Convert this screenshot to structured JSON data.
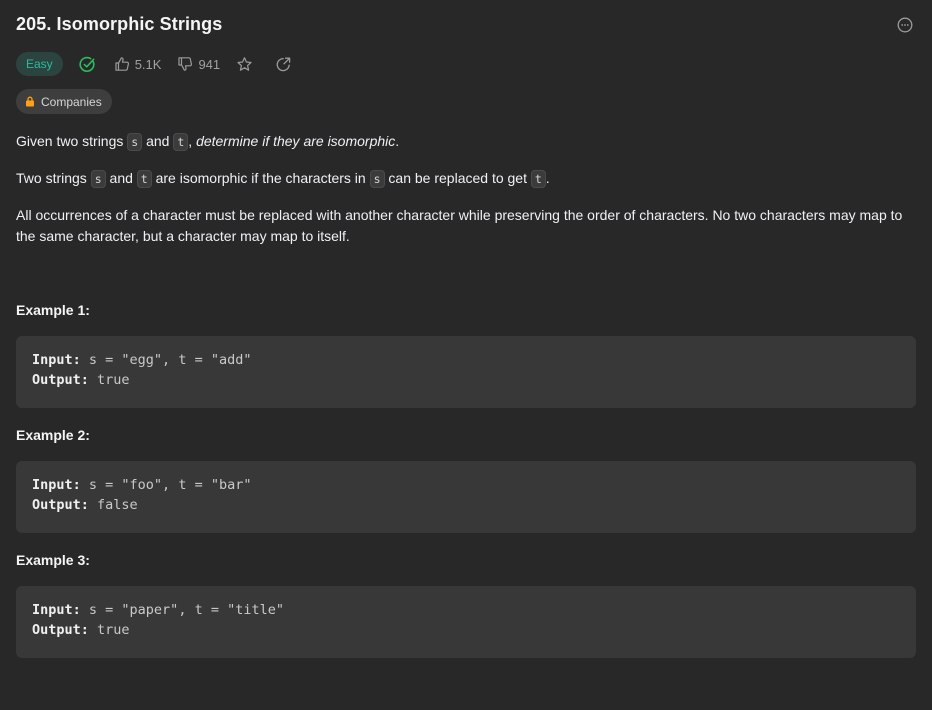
{
  "problem": {
    "title": "205. Isomorphic Strings",
    "difficulty": "Easy",
    "likes": "5.1K",
    "dislikes": "941",
    "companies_label": "Companies"
  },
  "description": {
    "p1_a": "Given two strings ",
    "p1_s": "s",
    "p1_b": " and ",
    "p1_t": "t",
    "p1_c": ", ",
    "p1_em": "determine if they are isomorphic",
    "p1_d": ".",
    "p2_a": "Two strings ",
    "p2_s": "s",
    "p2_b": " and ",
    "p2_t": "t",
    "p2_c": " are isomorphic if the characters in ",
    "p2_s2": "s",
    "p2_d": " can be replaced to get ",
    "p2_t2": "t",
    "p2_e": ".",
    "p3": "All occurrences of a character must be replaced with another character while preserving the order of characters. No two characters may map to the same character, but a character may map to itself."
  },
  "examples": [
    {
      "title": "Example 1:",
      "input_label": "Input:",
      "input": " s = \"egg\", t = \"add\"",
      "output_label": "Output:",
      "output": " true"
    },
    {
      "title": "Example 2:",
      "input_label": "Input:",
      "input": " s = \"foo\", t = \"bar\"",
      "output_label": "Output:",
      "output": " false"
    },
    {
      "title": "Example 3:",
      "input_label": "Input:",
      "input": " s = \"paper\", t = \"title\"",
      "output_label": "Output:",
      "output": " true"
    }
  ],
  "colors": {
    "background": "#282828",
    "easy": "#2cbb9f",
    "solved_check": "#2cbb5d",
    "lock": "#ffa116"
  }
}
